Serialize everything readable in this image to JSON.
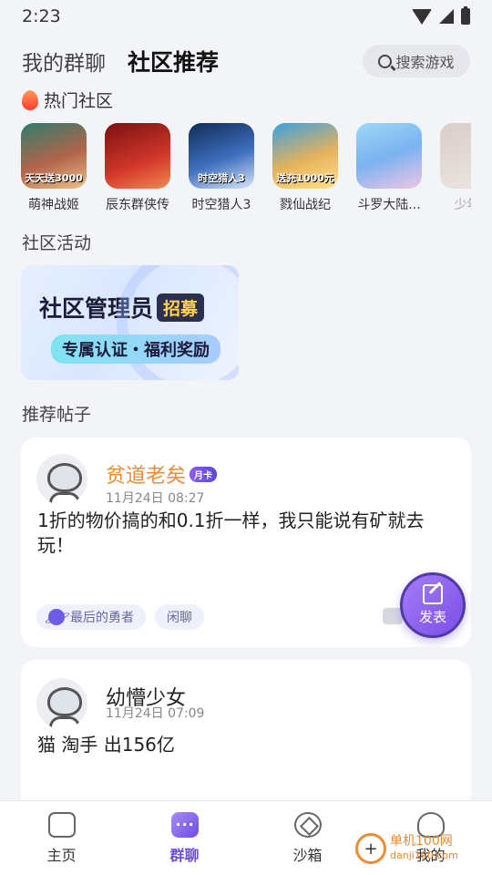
{
  "status_bar": {
    "time": "2:23"
  },
  "header": {
    "tabs": [
      {
        "label": "我的群聊",
        "active": false
      },
      {
        "label": "社区推荐",
        "active": true
      }
    ],
    "search_placeholder": "搜索游戏"
  },
  "hot_communities": {
    "title": "热门社区",
    "items": [
      {
        "name": "萌神战姬",
        "badge": "天天送3000"
      },
      {
        "name": "辰东群侠传",
        "badge": ""
      },
      {
        "name": "时空猎人3",
        "badge": "时空猎人3"
      },
      {
        "name": "戮仙战纪",
        "badge": "送充1000元"
      },
      {
        "name": "斗罗大陆...",
        "badge": ""
      },
      {
        "name": "少年...",
        "badge": ""
      }
    ]
  },
  "activities": {
    "title": "社区活动",
    "banner": {
      "line1": "社区管理员",
      "tag": "招募",
      "line2": "专属认证・福利奖励"
    }
  },
  "posts_section": {
    "title": "推荐帖子"
  },
  "posts": [
    {
      "author": "贫道老矣",
      "badge": "月卡",
      "time": "11月24日 08:27",
      "text": "1折的物价搞的和0.1折一样，我只能说有矿就去玩！",
      "tags": [
        "最后的勇者",
        "闲聊"
      ]
    },
    {
      "author": "幼懵少女",
      "time": "11月24日 07:09",
      "text": "猫 淘手 出156亿"
    }
  ],
  "fab": {
    "label": "发表"
  },
  "bottom_nav": [
    {
      "label": "主页",
      "icon": "gamepad-icon",
      "active": false
    },
    {
      "label": "群聊",
      "icon": "chat-icon",
      "active": true
    },
    {
      "label": "沙箱",
      "icon": "box-icon",
      "active": false
    },
    {
      "label": "我的",
      "icon": "user-icon",
      "active": false
    }
  ],
  "watermark": {
    "text": "单机100网",
    "sub": "danji100.com"
  },
  "colors": {
    "accent": "#6c4de0",
    "author_highlight": "#f08a33"
  }
}
